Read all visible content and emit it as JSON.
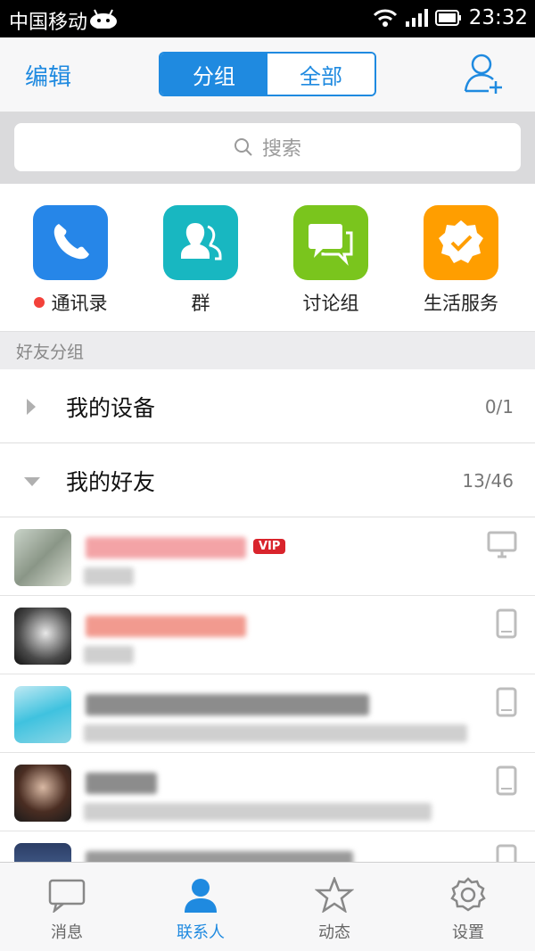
{
  "status": {
    "carrier": "中国移动",
    "time": "23:32"
  },
  "header": {
    "edit": "编辑",
    "seg_group": "分组",
    "seg_all": "全部"
  },
  "search": {
    "placeholder": "搜索"
  },
  "quick": [
    {
      "label": "通讯录",
      "color": "#2686e8",
      "icon": "phone-icon"
    },
    {
      "label": "群",
      "color": "#18b7c1",
      "icon": "group-icon"
    },
    {
      "label": "讨论组",
      "color": "#7ac51d",
      "icon": "discussion-icon"
    },
    {
      "label": "生活服务",
      "color": "#ff9e00",
      "icon": "verified-badge-icon"
    }
  ],
  "section": {
    "title": "好友分组"
  },
  "groups": [
    {
      "name": "我的设备",
      "count": "0/1",
      "expanded": false
    },
    {
      "name": "我的好友",
      "count": "13/46",
      "expanded": true
    }
  ],
  "friends": [
    {
      "vip": "VIP",
      "device": "desktop-icon"
    },
    {
      "device": "phone-device-icon"
    },
    {
      "device": "phone-device-icon"
    },
    {
      "device": "phone-device-icon"
    },
    {
      "device": "phone-device-icon"
    }
  ],
  "tabs": [
    {
      "label": "消息",
      "icon": "message-icon",
      "active": false
    },
    {
      "label": "联系人",
      "icon": "contacts-icon",
      "active": true
    },
    {
      "label": "动态",
      "icon": "star-icon",
      "active": false
    },
    {
      "label": "设置",
      "icon": "gear-icon",
      "active": false
    }
  ]
}
